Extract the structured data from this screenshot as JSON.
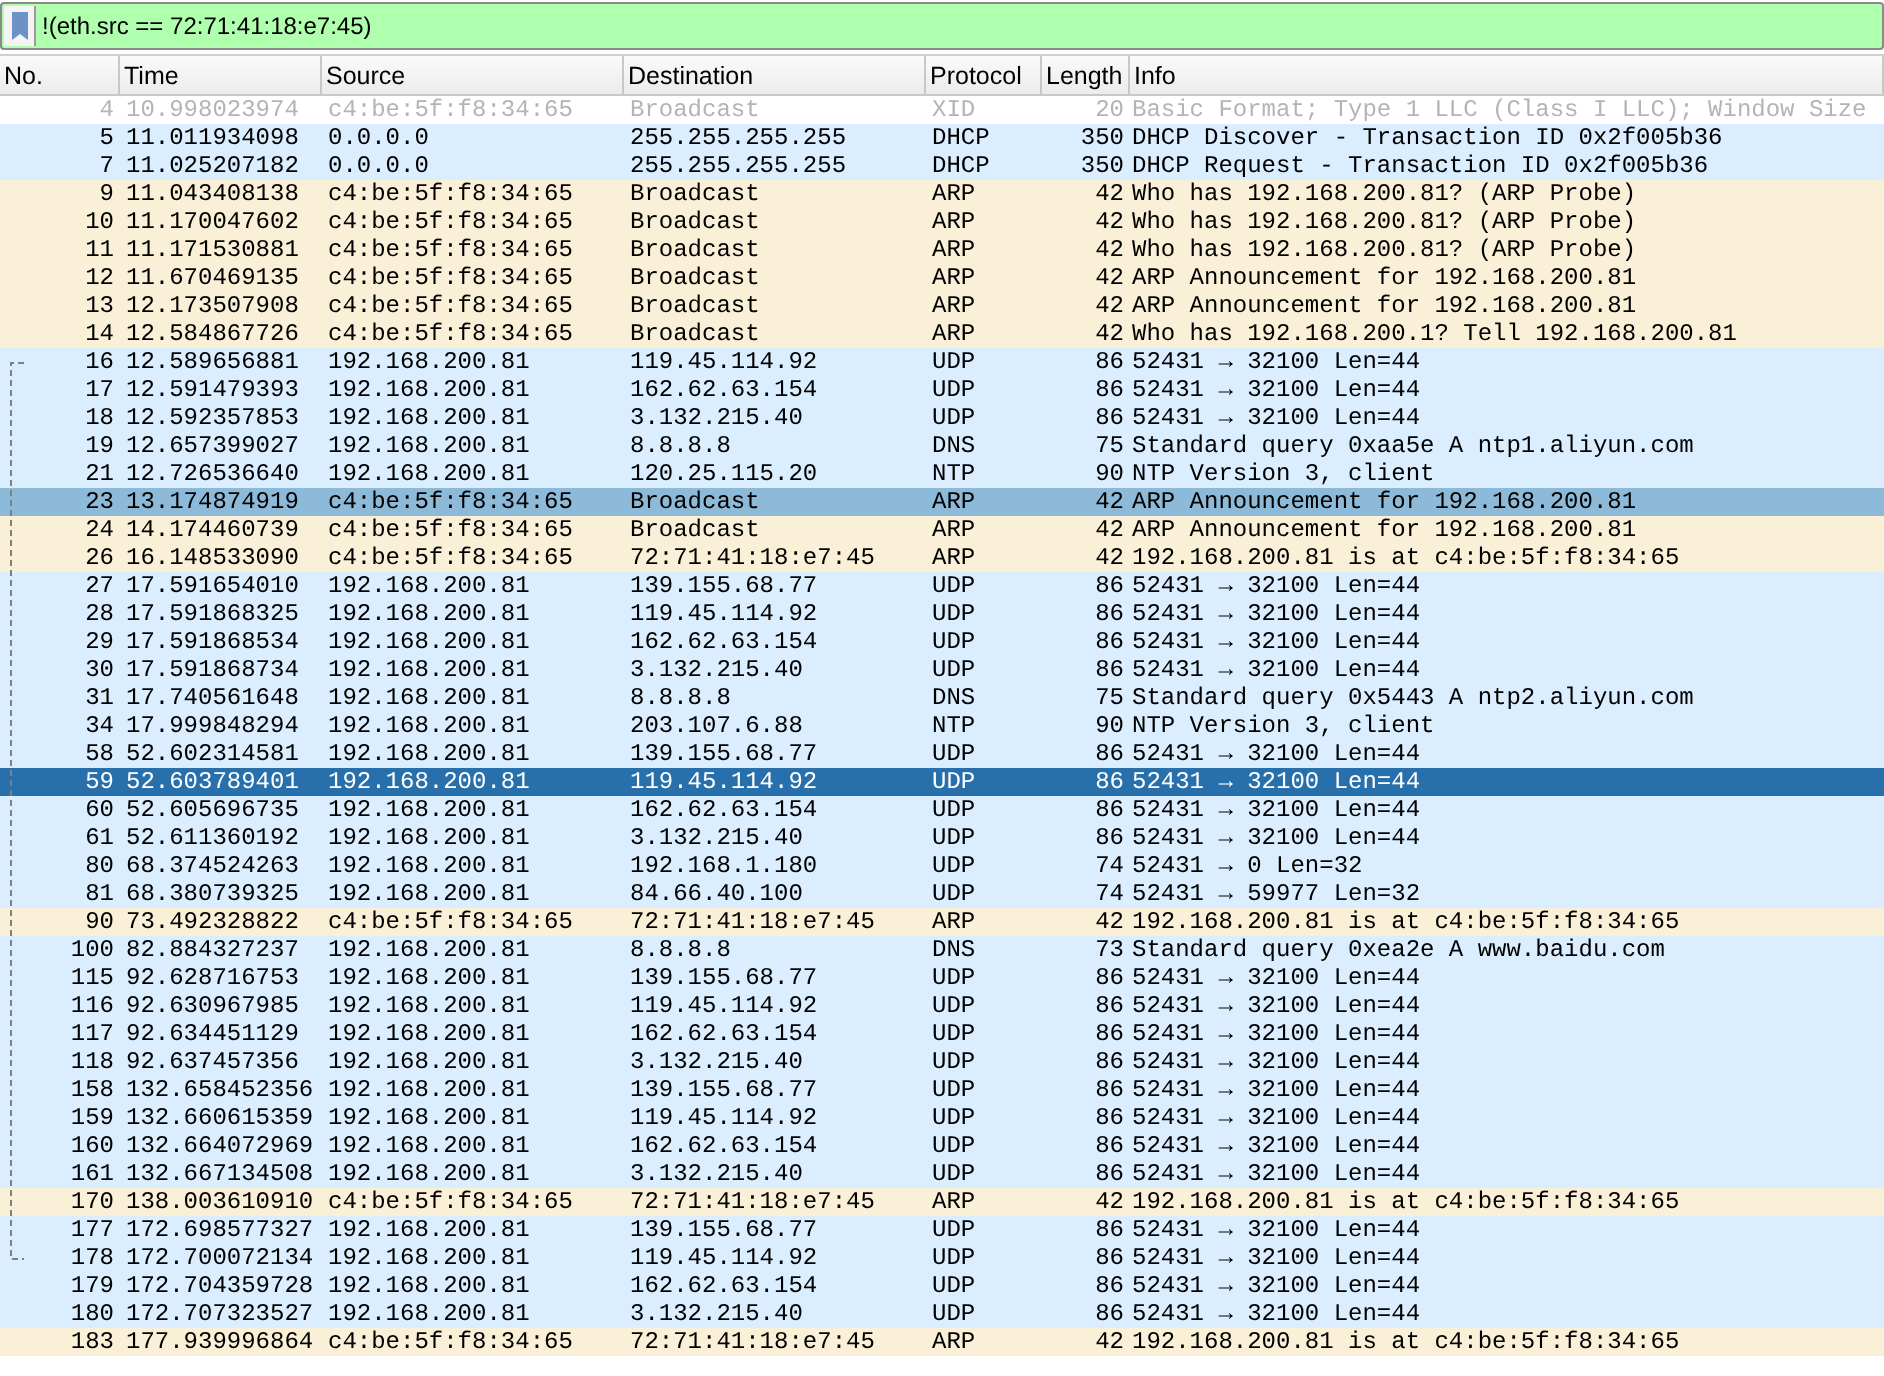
{
  "filter": {
    "value": "!(eth.src == 72:71:41:18:e7:45)"
  },
  "columns": [
    "No.",
    "Time",
    "Source",
    "Destination",
    "Protocol",
    "Length",
    "Info"
  ],
  "rows": [
    {
      "no": "4",
      "time": "10.998023974",
      "source": "c4:be:5f:f8:34:65",
      "destination": "Broadcast",
      "protocol": "XID",
      "length": "20",
      "info": "Basic Format; Type 1 LLC (Class I LLC); Window Size",
      "color": "#ffffff",
      "selected": false,
      "dimmed": true
    },
    {
      "no": "5",
      "time": "11.011934098",
      "source": "0.0.0.0",
      "destination": "255.255.255.255",
      "protocol": "DHCP",
      "length": "350",
      "info": "DHCP Discover - Transaction ID 0x2f005b36",
      "color": "#daeeff",
      "selected": false,
      "dimmed": false
    },
    {
      "no": "7",
      "time": "11.025207182",
      "source": "0.0.0.0",
      "destination": "255.255.255.255",
      "protocol": "DHCP",
      "length": "350",
      "info": "DHCP Request  - Transaction ID 0x2f005b36",
      "color": "#daeeff",
      "selected": false,
      "dimmed": false
    },
    {
      "no": "9",
      "time": "11.043408138",
      "source": "c4:be:5f:f8:34:65",
      "destination": "Broadcast",
      "protocol": "ARP",
      "length": "42",
      "info": "Who has 192.168.200.81? (ARP Probe)",
      "color": "#faf0d7",
      "selected": false,
      "dimmed": false
    },
    {
      "no": "10",
      "time": "11.170047602",
      "source": "c4:be:5f:f8:34:65",
      "destination": "Broadcast",
      "protocol": "ARP",
      "length": "42",
      "info": "Who has 192.168.200.81? (ARP Probe)",
      "color": "#faf0d7",
      "selected": false,
      "dimmed": false
    },
    {
      "no": "11",
      "time": "11.171530881",
      "source": "c4:be:5f:f8:34:65",
      "destination": "Broadcast",
      "protocol": "ARP",
      "length": "42",
      "info": "Who has 192.168.200.81? (ARP Probe)",
      "color": "#faf0d7",
      "selected": false,
      "dimmed": false
    },
    {
      "no": "12",
      "time": "11.670469135",
      "source": "c4:be:5f:f8:34:65",
      "destination": "Broadcast",
      "protocol": "ARP",
      "length": "42",
      "info": "ARP Announcement for 192.168.200.81",
      "color": "#faf0d7",
      "selected": false,
      "dimmed": false
    },
    {
      "no": "13",
      "time": "12.173507908",
      "source": "c4:be:5f:f8:34:65",
      "destination": "Broadcast",
      "protocol": "ARP",
      "length": "42",
      "info": "ARP Announcement for 192.168.200.81",
      "color": "#faf0d7",
      "selected": false,
      "dimmed": false
    },
    {
      "no": "14",
      "time": "12.584867726",
      "source": "c4:be:5f:f8:34:65",
      "destination": "Broadcast",
      "protocol": "ARP",
      "length": "42",
      "info": "Who has 192.168.200.1? Tell 192.168.200.81",
      "color": "#faf0d7",
      "selected": false,
      "dimmed": false
    },
    {
      "no": "16",
      "time": "12.589656881",
      "source": "192.168.200.81",
      "destination": "119.45.114.92",
      "protocol": "UDP",
      "length": "86",
      "info": "52431 → 32100 Len=44",
      "color": "#daeeff",
      "selected": false,
      "dimmed": false,
      "related": true
    },
    {
      "no": "17",
      "time": "12.591479393",
      "source": "192.168.200.81",
      "destination": "162.62.63.154",
      "protocol": "UDP",
      "length": "86",
      "info": "52431 → 32100 Len=44",
      "color": "#daeeff",
      "selected": false,
      "dimmed": false,
      "related": true
    },
    {
      "no": "18",
      "time": "12.592357853",
      "source": "192.168.200.81",
      "destination": "3.132.215.40",
      "protocol": "UDP",
      "length": "86",
      "info": "52431 → 32100 Len=44",
      "color": "#daeeff",
      "selected": false,
      "dimmed": false,
      "related": true
    },
    {
      "no": "19",
      "time": "12.657399027",
      "source": "192.168.200.81",
      "destination": "8.8.8.8",
      "protocol": "DNS",
      "length": "75",
      "info": "Standard query 0xaa5e A ntp1.aliyun.com",
      "color": "#daeeff",
      "selected": false,
      "dimmed": false,
      "related": true
    },
    {
      "no": "21",
      "time": "12.726536640",
      "source": "192.168.200.81",
      "destination": "120.25.115.20",
      "protocol": "NTP",
      "length": "90",
      "info": "NTP Version 3, client",
      "color": "#daeeff",
      "selected": false,
      "dimmed": false,
      "related": true
    },
    {
      "no": "23",
      "time": "13.174874919",
      "source": "c4:be:5f:f8:34:65",
      "destination": "Broadcast",
      "protocol": "ARP",
      "length": "42",
      "info": "ARP Announcement for 192.168.200.81",
      "color": "#8dbad8",
      "selected": false,
      "dimmed": false,
      "related": true
    },
    {
      "no": "24",
      "time": "14.174460739",
      "source": "c4:be:5f:f8:34:65",
      "destination": "Broadcast",
      "protocol": "ARP",
      "length": "42",
      "info": "ARP Announcement for 192.168.200.81",
      "color": "#faf0d7",
      "selected": false,
      "dimmed": false,
      "related": true
    },
    {
      "no": "26",
      "time": "16.148533090",
      "source": "c4:be:5f:f8:34:65",
      "destination": "72:71:41:18:e7:45",
      "protocol": "ARP",
      "length": "42",
      "info": "192.168.200.81 is at c4:be:5f:f8:34:65",
      "color": "#faf0d7",
      "selected": false,
      "dimmed": false,
      "related": true
    },
    {
      "no": "27",
      "time": "17.591654010",
      "source": "192.168.200.81",
      "destination": "139.155.68.77",
      "protocol": "UDP",
      "length": "86",
      "info": "52431 → 32100 Len=44",
      "color": "#daeeff",
      "selected": false,
      "dimmed": false,
      "related": true
    },
    {
      "no": "28",
      "time": "17.591868325",
      "source": "192.168.200.81",
      "destination": "119.45.114.92",
      "protocol": "UDP",
      "length": "86",
      "info": "52431 → 32100 Len=44",
      "color": "#daeeff",
      "selected": false,
      "dimmed": false,
      "related": true
    },
    {
      "no": "29",
      "time": "17.591868534",
      "source": "192.168.200.81",
      "destination": "162.62.63.154",
      "protocol": "UDP",
      "length": "86",
      "info": "52431 → 32100 Len=44",
      "color": "#daeeff",
      "selected": false,
      "dimmed": false,
      "related": true
    },
    {
      "no": "30",
      "time": "17.591868734",
      "source": "192.168.200.81",
      "destination": "3.132.215.40",
      "protocol": "UDP",
      "length": "86",
      "info": "52431 → 32100 Len=44",
      "color": "#daeeff",
      "selected": false,
      "dimmed": false,
      "related": true
    },
    {
      "no": "31",
      "time": "17.740561648",
      "source": "192.168.200.81",
      "destination": "8.8.8.8",
      "protocol": "DNS",
      "length": "75",
      "info": "Standard query 0x5443 A ntp2.aliyun.com",
      "color": "#daeeff",
      "selected": false,
      "dimmed": false,
      "related": true
    },
    {
      "no": "34",
      "time": "17.999848294",
      "source": "192.168.200.81",
      "destination": "203.107.6.88",
      "protocol": "NTP",
      "length": "90",
      "info": "NTP Version 3, client",
      "color": "#daeeff",
      "selected": false,
      "dimmed": false,
      "related": true
    },
    {
      "no": "58",
      "time": "52.602314581",
      "source": "192.168.200.81",
      "destination": "139.155.68.77",
      "protocol": "UDP",
      "length": "86",
      "info": "52431 → 32100 Len=44",
      "color": "#daeeff",
      "selected": false,
      "dimmed": false,
      "related": true
    },
    {
      "no": "59",
      "time": "52.603789401",
      "source": "192.168.200.81",
      "destination": "119.45.114.92",
      "protocol": "UDP",
      "length": "86",
      "info": "52431 → 32100 Len=44",
      "selected": true,
      "dimmed": false,
      "related": true
    },
    {
      "no": "60",
      "time": "52.605696735",
      "source": "192.168.200.81",
      "destination": "162.62.63.154",
      "protocol": "UDP",
      "length": "86",
      "info": "52431 → 32100 Len=44",
      "color": "#daeeff",
      "selected": false,
      "dimmed": false,
      "related": true
    },
    {
      "no": "61",
      "time": "52.611360192",
      "source": "192.168.200.81",
      "destination": "3.132.215.40",
      "protocol": "UDP",
      "length": "86",
      "info": "52431 → 32100 Len=44",
      "color": "#daeeff",
      "selected": false,
      "dimmed": false,
      "related": true
    },
    {
      "no": "80",
      "time": "68.374524263",
      "source": "192.168.200.81",
      "destination": "192.168.1.180",
      "protocol": "UDP",
      "length": "74",
      "info": "52431 → 0 Len=32",
      "color": "#daeeff",
      "selected": false,
      "dimmed": false,
      "related": true
    },
    {
      "no": "81",
      "time": "68.380739325",
      "source": "192.168.200.81",
      "destination": "84.66.40.100",
      "protocol": "UDP",
      "length": "74",
      "info": "52431 → 59977 Len=32",
      "color": "#daeeff",
      "selected": false,
      "dimmed": false,
      "related": true
    },
    {
      "no": "90",
      "time": "73.492328822",
      "source": "c4:be:5f:f8:34:65",
      "destination": "72:71:41:18:e7:45",
      "protocol": "ARP",
      "length": "42",
      "info": "192.168.200.81 is at c4:be:5f:f8:34:65",
      "color": "#faf0d7",
      "selected": false,
      "dimmed": false,
      "related": true
    },
    {
      "no": "100",
      "time": "82.884327237",
      "source": "192.168.200.81",
      "destination": "8.8.8.8",
      "protocol": "DNS",
      "length": "73",
      "info": "Standard query 0xea2e A www.baidu.com",
      "color": "#daeeff",
      "selected": false,
      "dimmed": false,
      "related": true
    },
    {
      "no": "115",
      "time": "92.628716753",
      "source": "192.168.200.81",
      "destination": "139.155.68.77",
      "protocol": "UDP",
      "length": "86",
      "info": "52431 → 32100 Len=44",
      "color": "#daeeff",
      "selected": false,
      "dimmed": false,
      "related": true
    },
    {
      "no": "116",
      "time": "92.630967985",
      "source": "192.168.200.81",
      "destination": "119.45.114.92",
      "protocol": "UDP",
      "length": "86",
      "info": "52431 → 32100 Len=44",
      "color": "#daeeff",
      "selected": false,
      "dimmed": false,
      "related": true
    },
    {
      "no": "117",
      "time": "92.634451129",
      "source": "192.168.200.81",
      "destination": "162.62.63.154",
      "protocol": "UDP",
      "length": "86",
      "info": "52431 → 32100 Len=44",
      "color": "#daeeff",
      "selected": false,
      "dimmed": false,
      "related": true
    },
    {
      "no": "118",
      "time": "92.637457356",
      "source": "192.168.200.81",
      "destination": "3.132.215.40",
      "protocol": "UDP",
      "length": "86",
      "info": "52431 → 32100 Len=44",
      "color": "#daeeff",
      "selected": false,
      "dimmed": false,
      "related": true
    },
    {
      "no": "158",
      "time": "132.658452356",
      "source": "192.168.200.81",
      "destination": "139.155.68.77",
      "protocol": "UDP",
      "length": "86",
      "info": "52431 → 32100 Len=44",
      "color": "#daeeff",
      "selected": false,
      "dimmed": false,
      "related": true
    },
    {
      "no": "159",
      "time": "132.660615359",
      "source": "192.168.200.81",
      "destination": "119.45.114.92",
      "protocol": "UDP",
      "length": "86",
      "info": "52431 → 32100 Len=44",
      "color": "#daeeff",
      "selected": false,
      "dimmed": false,
      "related": true
    },
    {
      "no": "160",
      "time": "132.664072969",
      "source": "192.168.200.81",
      "destination": "162.62.63.154",
      "protocol": "UDP",
      "length": "86",
      "info": "52431 → 32100 Len=44",
      "color": "#daeeff",
      "selected": false,
      "dimmed": false,
      "related": true
    },
    {
      "no": "161",
      "time": "132.667134508",
      "source": "192.168.200.81",
      "destination": "3.132.215.40",
      "protocol": "UDP",
      "length": "86",
      "info": "52431 → 32100 Len=44",
      "color": "#daeeff",
      "selected": false,
      "dimmed": false,
      "related": true
    },
    {
      "no": "170",
      "time": "138.003610910",
      "source": "c4:be:5f:f8:34:65",
      "destination": "72:71:41:18:e7:45",
      "protocol": "ARP",
      "length": "42",
      "info": "192.168.200.81 is at c4:be:5f:f8:34:65",
      "color": "#faf0d7",
      "selected": false,
      "dimmed": false,
      "related": true
    },
    {
      "no": "177",
      "time": "172.698577327",
      "source": "192.168.200.81",
      "destination": "139.155.68.77",
      "protocol": "UDP",
      "length": "86",
      "info": "52431 → 32100 Len=44",
      "color": "#daeeff",
      "selected": false,
      "dimmed": false,
      "related": true
    },
    {
      "no": "178",
      "time": "172.700072134",
      "source": "192.168.200.81",
      "destination": "119.45.114.92",
      "protocol": "UDP",
      "length": "86",
      "info": "52431 → 32100 Len=44",
      "color": "#daeeff",
      "selected": false,
      "dimmed": false,
      "related": true
    },
    {
      "no": "179",
      "time": "172.704359728",
      "source": "192.168.200.81",
      "destination": "162.62.63.154",
      "protocol": "UDP",
      "length": "86",
      "info": "52431 → 32100 Len=44",
      "color": "#daeeff",
      "selected": false,
      "dimmed": false
    },
    {
      "no": "180",
      "time": "172.707323527",
      "source": "192.168.200.81",
      "destination": "3.132.215.40",
      "protocol": "UDP",
      "length": "86",
      "info": "52431 → 32100 Len=44",
      "color": "#daeeff",
      "selected": false,
      "dimmed": false
    },
    {
      "no": "183",
      "time": "177.939996864",
      "source": "c4:be:5f:f8:34:65",
      "destination": "72:71:41:18:e7:45",
      "protocol": "ARP",
      "length": "42",
      "info": "192.168.200.81 is at c4:be:5f:f8:34:65",
      "color": "#faf0d7",
      "selected": false,
      "dimmed": false
    }
  ]
}
